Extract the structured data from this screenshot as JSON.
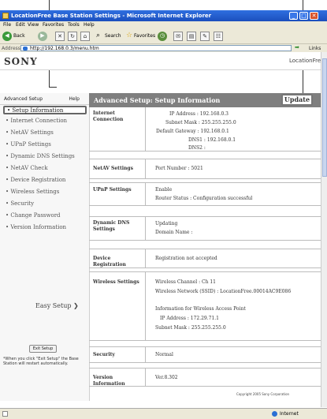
{
  "window": {
    "title": "LocationFree Base Station Settings - Microsoft Internet Explorer",
    "min_glyph": "_",
    "max_glyph": "□",
    "close_glyph": "✕"
  },
  "menu": [
    "File",
    "Edit",
    "View",
    "Favorites",
    "Tools",
    "Help"
  ],
  "toolbar": {
    "back_label": "Back",
    "search_label": "Search",
    "favorites_label": "Favorites",
    "links_label": "Links"
  },
  "address": {
    "label": "Address",
    "url": "http://192.168.0.3/menu.htm"
  },
  "header": {
    "brand": "SONY",
    "product_logo": "LocationFree"
  },
  "sidebar": {
    "section_title": "Advanced Setup",
    "help_label": "Help",
    "items": [
      {
        "label": "• Setup Information"
      },
      {
        "label": "• Internet Connection"
      },
      {
        "label": "• NetAV Settings"
      },
      {
        "label": "• UPnP Settings"
      },
      {
        "label": "• Dynamic DNS Settings"
      },
      {
        "label": "• NetAV Check"
      },
      {
        "label": "• Device Registration"
      },
      {
        "label": "• Wireless Settings"
      },
      {
        "label": "• Security"
      },
      {
        "label": "• Change Password"
      },
      {
        "label": "• Version Information"
      }
    ],
    "easy_setup": "Easy Setup ❯",
    "exit_button": "Exit Setup",
    "exit_note": "*When you click \"Exit Setup\" the Base Station will restart automatically."
  },
  "main": {
    "title": "Advanced Setup: Setup Information",
    "update_button": "Update",
    "sections": {
      "internet": {
        "label": "Internet Connection",
        "ip": "IP Address : 192.168.0.3",
        "subnet": "Subnet Mask : 255.255.255.0",
        "gateway": "Default Gateway : 192.168.0.1",
        "dns1": "DNS1 : 192.168.0.1",
        "dns2": "DNS2 :"
      },
      "netav": {
        "label": "NetAV Settings",
        "port": "Port Number : 5021"
      },
      "upnp": {
        "label": "UPnP Settings",
        "enable": "Enable",
        "router_status": "Router Status : Configuration successful"
      },
      "ddns": {
        "label": "Dynamic DNS Settings",
        "status": "Updating",
        "domain": "Domain Name :"
      },
      "device": {
        "label": "Device Registration",
        "status": "Registration not accepted"
      },
      "wireless": {
        "label": "Wireless Settings",
        "channel": "Wireless Channel : Ch 11",
        "ssid": "Wireless Network (SSID) : LocationFree.00014AC9E086",
        "info_title": "Information for Wireless Access Point",
        "ip": "IP Address : 172.29.71.1",
        "subnet": "Subnet Mask : 255.255.255.0"
      },
      "security": {
        "label": "Security",
        "value": "Normal"
      },
      "version": {
        "label": "Version Information",
        "value": "Ver.8.302"
      }
    },
    "copyright": "Copyright 2005 Sony Corporation"
  },
  "status": {
    "zone": "Internet"
  }
}
